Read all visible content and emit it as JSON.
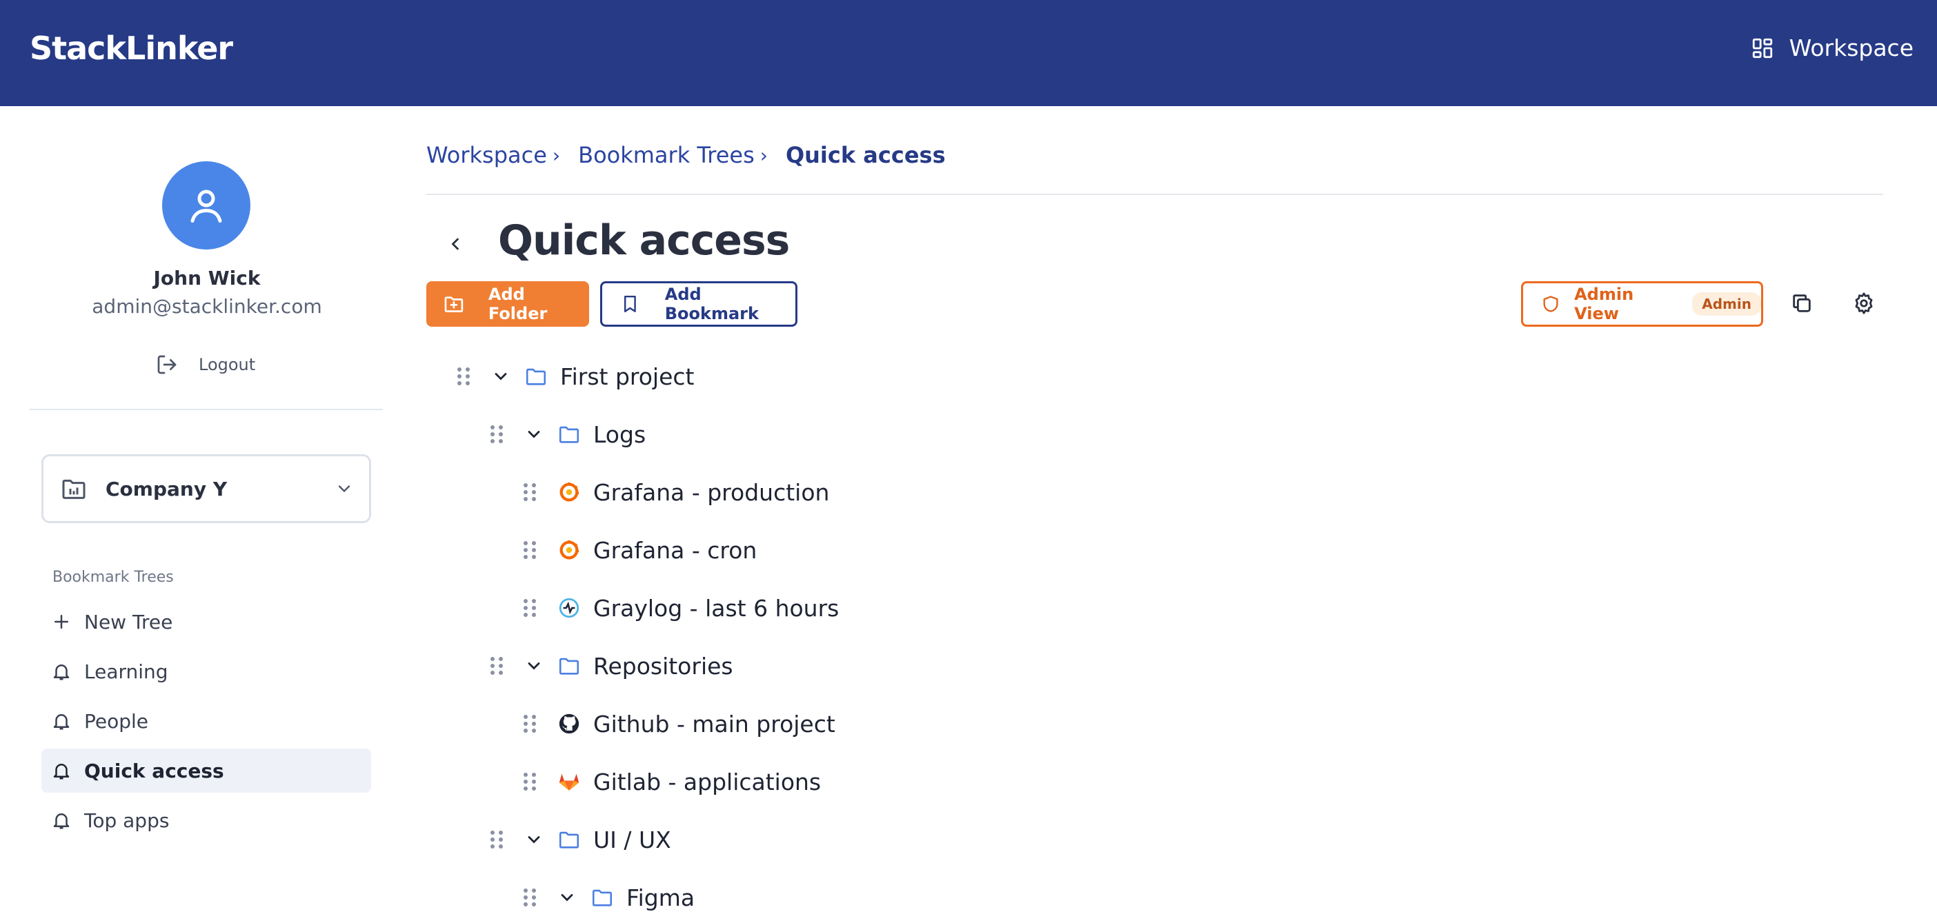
{
  "header": {
    "brand": "StackLinker",
    "workspace_label": "Workspace",
    "workspace_icon": "grid-icon"
  },
  "user": {
    "name": "John Wick",
    "email": "admin@stacklinker.com",
    "logout_label": "Logout"
  },
  "company": {
    "selected": "Company Y"
  },
  "sidebar": {
    "section_label": "Bookmark Trees",
    "items": [
      {
        "label": "New Tree",
        "icon": "plus-icon",
        "active": false
      },
      {
        "label": "Learning",
        "icon": "bell-icon",
        "active": false
      },
      {
        "label": "People",
        "icon": "bell-icon",
        "active": false
      },
      {
        "label": "Quick access",
        "icon": "bell-icon",
        "active": true
      },
      {
        "label": "Top apps",
        "icon": "bell-icon",
        "active": false
      }
    ]
  },
  "breadcrumb": {
    "items": [
      "Workspace",
      "Bookmark Trees"
    ],
    "current": "Quick access"
  },
  "page": {
    "title": "Quick access"
  },
  "toolbar": {
    "add_folder_label": "Add Folder",
    "add_bookmark_label": "Add Bookmark",
    "admin_view_label": "Admin View",
    "admin_badge": "Admin"
  },
  "tree": [
    {
      "label": "First project",
      "type": "folder",
      "depth": 0,
      "expanded": true
    },
    {
      "label": "Logs",
      "type": "folder",
      "depth": 1,
      "expanded": true
    },
    {
      "label": "Grafana - production",
      "type": "bookmark",
      "depth": 2,
      "icon": "grafana-icon"
    },
    {
      "label": "Grafana - cron",
      "type": "bookmark",
      "depth": 2,
      "icon": "grafana-icon"
    },
    {
      "label": "Graylog - last 6 hours",
      "type": "bookmark",
      "depth": 2,
      "icon": "graylog-icon"
    },
    {
      "label": "Repositories",
      "type": "folder",
      "depth": 1,
      "expanded": true
    },
    {
      "label": "Github - main project",
      "type": "bookmark",
      "depth": 2,
      "icon": "github-icon"
    },
    {
      "label": "Gitlab - applications",
      "type": "bookmark",
      "depth": 2,
      "icon": "gitlab-icon"
    },
    {
      "label": "UI / UX",
      "type": "folder",
      "depth": 1,
      "expanded": true
    },
    {
      "label": "Figma",
      "type": "folder",
      "depth": 2,
      "expanded": true
    }
  ],
  "colors": {
    "header": "#263a86",
    "accent_orange": "#f07f33",
    "admin_orange": "#ec6a1e",
    "avatar": "#4a86e8",
    "folder_blue": "#4a7fe0"
  }
}
